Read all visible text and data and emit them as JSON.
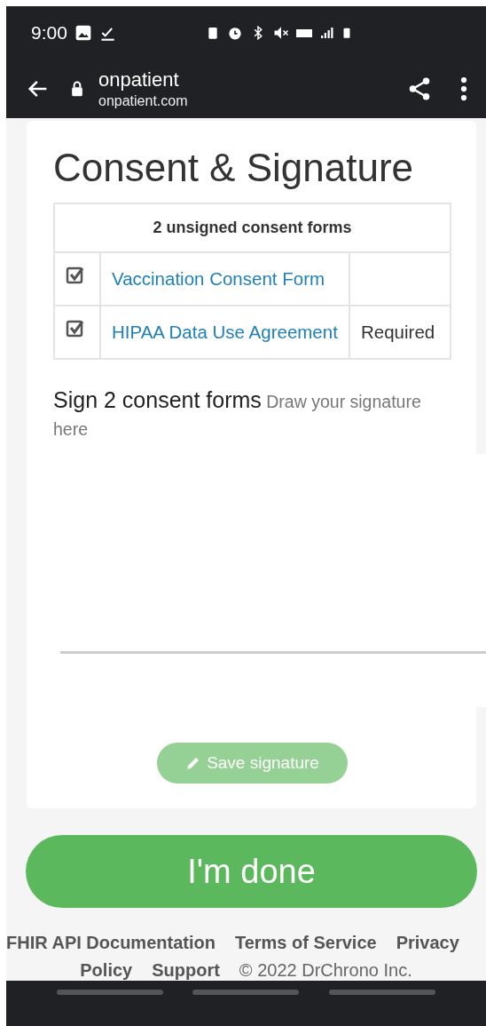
{
  "status_bar": {
    "time": "9:00"
  },
  "browser": {
    "title": "onpatient",
    "url": "onpatient.com"
  },
  "page": {
    "heading": "Consent & Signature",
    "forms_table": {
      "header": "2 unsigned consent forms",
      "rows": [
        {
          "checked": true,
          "name": "Vaccination Consent Form"
        },
        {
          "checked": true,
          "name": "HIPAA Data Use Agreement",
          "note": "Required"
        }
      ]
    },
    "sign_title": "Sign 2 consent forms",
    "sign_hint": "Draw your signature here",
    "save_button": {
      "label": "Save signature",
      "disabled": true
    },
    "done_button": "I'm done"
  },
  "footer": {
    "lines": [
      [
        "FHIR API Documentation",
        "Terms of Service",
        "Privacy"
      ],
      [
        "Policy",
        "Support"
      ]
    ],
    "copyright": "© 2022 DrChrono Inc."
  }
}
